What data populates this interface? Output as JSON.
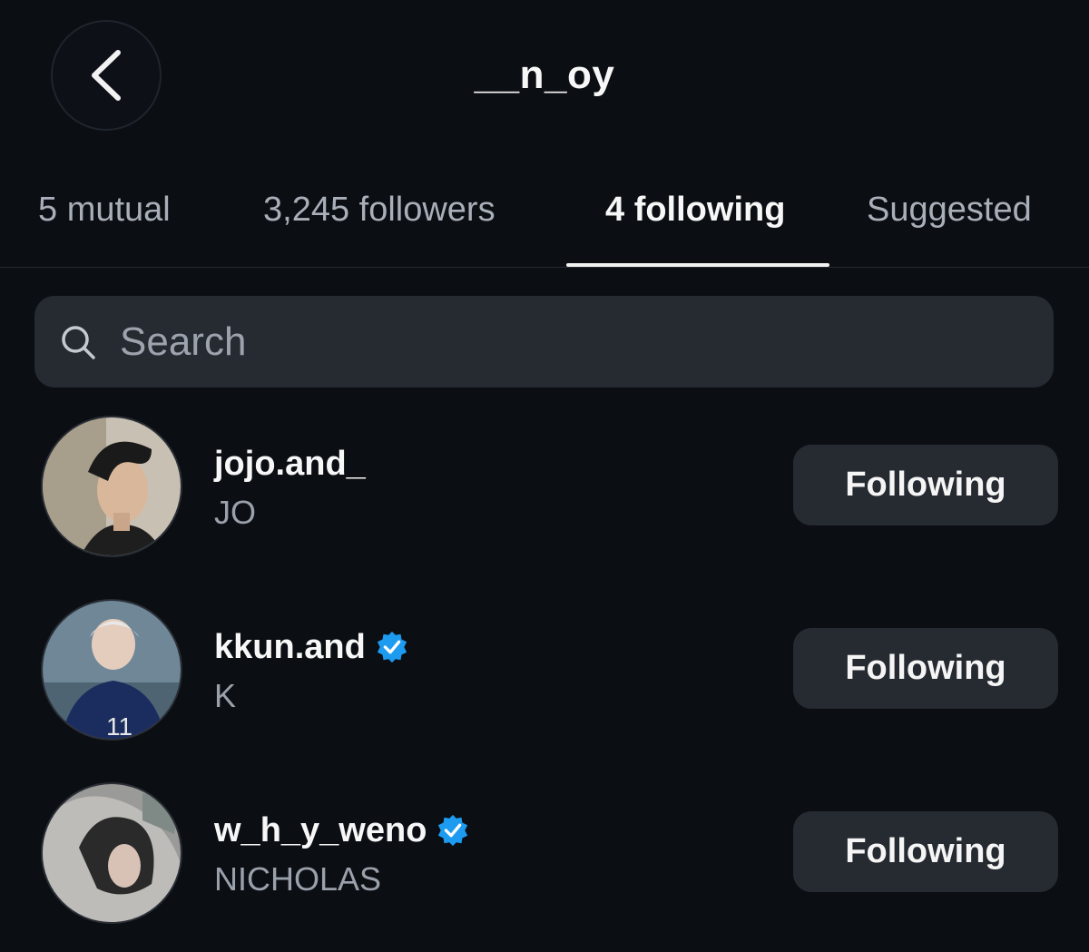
{
  "header": {
    "title": "__n_oy",
    "back_icon": "chevron-left-icon"
  },
  "tabs": [
    {
      "label": "5 mutual",
      "active": false
    },
    {
      "label": "3,245 followers",
      "active": false
    },
    {
      "label": "4 following",
      "active": true
    },
    {
      "label": "Suggested",
      "active": false
    }
  ],
  "search": {
    "placeholder": "Search",
    "value": "",
    "icon": "search-icon"
  },
  "accounts": [
    {
      "username": "jojo.and_",
      "name": "JO",
      "verified": false,
      "button_label": "Following"
    },
    {
      "username": "kkun.and",
      "name": "K",
      "verified": true,
      "button_label": "Following"
    },
    {
      "username": "w_h_y_weno",
      "name": "NICHOLAS",
      "verified": true,
      "button_label": "Following"
    }
  ],
  "colors": {
    "background": "#0b0e13",
    "button": "#262a31",
    "verified": "#1d9bf0",
    "muted_text": "#9aa1ab"
  }
}
